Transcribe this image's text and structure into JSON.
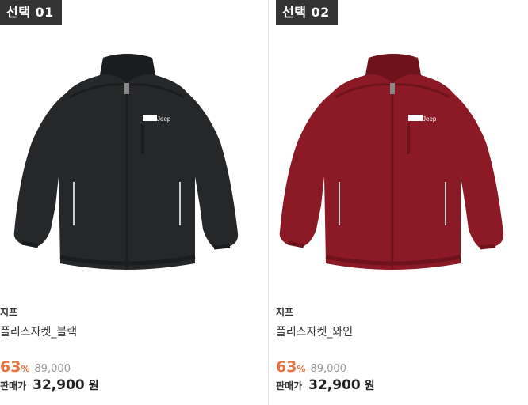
{
  "products": [
    {
      "badge": "선택 01",
      "brand": "지프",
      "name": "플리스자켓_블랙",
      "discount_rate": "63",
      "discount_unit": "%",
      "original_price": "89,000",
      "sale_label": "판매가",
      "sale_price": "32,900",
      "currency": "원",
      "jacket_color": "#262728",
      "jacket_shade": "#1b1c1d",
      "logo_text": "Jeep"
    },
    {
      "badge": "선택 02",
      "brand": "지프",
      "name": "플리스자켓_와인",
      "discount_rate": "63",
      "discount_unit": "%",
      "original_price": "89,000",
      "sale_label": "판매가",
      "sale_price": "32,900",
      "currency": "원",
      "jacket_color": "#8c1a26",
      "jacket_shade": "#6e121c",
      "logo_text": "Jeep"
    }
  ],
  "colors": {
    "accent": "#e8713f",
    "badge_bg": "#333333",
    "text": "#333333",
    "muted": "#999999"
  }
}
